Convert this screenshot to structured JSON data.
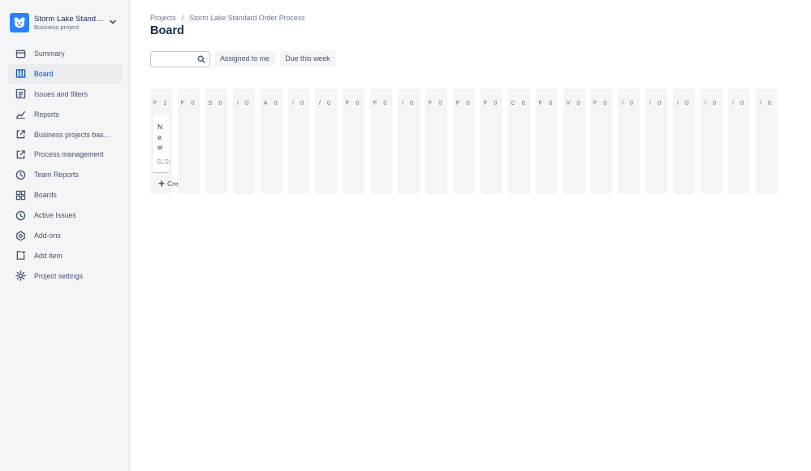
{
  "project": {
    "name": "Storm Lake Standard Order Process",
    "type": "Business project"
  },
  "nav": [
    {
      "label": "Summary",
      "icon": "summary-icon"
    },
    {
      "label": "Board",
      "icon": "board-icon",
      "active": true
    },
    {
      "label": "Issues and filters",
      "icon": "issues-icon"
    },
    {
      "label": "Reports",
      "icon": "reports-icon"
    },
    {
      "label": "Business projects basics",
      "icon": "external-link-icon"
    },
    {
      "label": "Process management",
      "icon": "external-link-icon"
    },
    {
      "label": "Team Reports",
      "icon": "clock-icon"
    },
    {
      "label": "Boards",
      "icon": "boards-icon"
    },
    {
      "label": "Active Issues",
      "icon": "clock-icon"
    },
    {
      "label": "Add-ons",
      "icon": "addons-icon"
    },
    {
      "label": "Add item",
      "icon": "add-item-icon"
    },
    {
      "label": "Project settings",
      "icon": "gear-icon"
    }
  ],
  "breadcrumb": {
    "root": "Projects",
    "separator": "/",
    "project": "Storm Lake Standard Order Process"
  },
  "page": {
    "title": "Board"
  },
  "filters": {
    "search_placeholder": "",
    "assigned_label": "Assigned to me",
    "due_label": "Due this week"
  },
  "board": {
    "columns": [
      {
        "head": "F 1"
      },
      {
        "head": "F 0"
      },
      {
        "head": "S 0"
      },
      {
        "head": "/ 0"
      },
      {
        "head": "A 0"
      },
      {
        "head": "/ 0"
      },
      {
        "head": "/ 0"
      },
      {
        "head": "F 0"
      },
      {
        "head": "F 0"
      },
      {
        "head": "/ 0"
      },
      {
        "head": "F 0"
      },
      {
        "head": "F 0"
      },
      {
        "head": "F 0"
      },
      {
        "head": "C 0"
      },
      {
        "head": "F 0"
      },
      {
        "head": "V 0"
      },
      {
        "head": "F 0"
      },
      {
        "head": "/ 0"
      },
      {
        "head": "/ 0"
      },
      {
        "head": "/ 0"
      },
      {
        "head": "/ 0"
      },
      {
        "head": "/ 0"
      },
      {
        "head": "/ 0"
      }
    ],
    "card": {
      "title": "New",
      "key": "SLSOP-"
    },
    "create_label": "Cre"
  },
  "colors": {
    "accent": "#0052cc",
    "sidebar_bg": "#f4f5f7",
    "avatar": "#2684ff"
  }
}
